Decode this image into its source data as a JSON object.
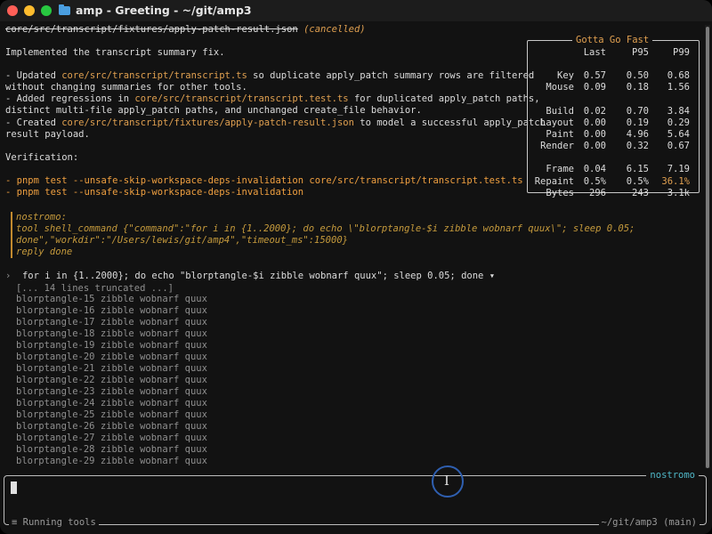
{
  "window": {
    "title": "amp - Greeting - ~/git/amp3"
  },
  "header": {
    "file": "core/src/transcript/fixtures/apply-patch-result.json",
    "status": "(cancelled)"
  },
  "summary": {
    "intro": "Implemented the transcript summary fix.",
    "b1_prefix": "- Updated ",
    "b1_path": "core/src/transcript/transcript.ts",
    "b1_rest": " so duplicate apply_patch summary rows are filtered",
    "b1_line2": "without changing summaries for other tools.",
    "b2_prefix": "- Added regressions in ",
    "b2_path": "core/src/transcript/transcript.test.ts",
    "b2_rest": " for duplicated apply_patch paths,",
    "b2_line2": "distinct multi-file apply_patch paths, and unchanged create_file behavior.",
    "b3_prefix": "- Created ",
    "b3_path": "core/src/transcript/fixtures/apply-patch-result.json",
    "b3_rest": " to model a successful apply_patch",
    "b3_line2": "result payload.",
    "verification": "Verification:",
    "v1_dash": "- ",
    "v1_cmd": "pnpm test --unsafe-skip-workspace-deps-invalidation core/src/transcript/transcript.test.ts",
    "v2_dash": "- ",
    "v2_cmd": "pnpm test --unsafe-skip-workspace-deps-invalidation"
  },
  "nostromo": {
    "header": "nostromo:",
    "line1": "tool shell_command {\"command\":\"for i in {1..2000}; do echo \\\"blorptangle-$i zibble wobnarf quux\\\"; sleep 0.05;",
    "line2": "done\",\"workdir\":\"/Users/lewis/git/amp4\",\"timeout_ms\":15000}",
    "line3": "reply done"
  },
  "shell": {
    "prompt": "›",
    "command": "for i in {1..2000}; do echo \"blorptangle-$i zibble wobnarf quux\"; sleep 0.05; done",
    "toggle": "▾",
    "truncated": "[... 14 lines truncated ...]",
    "output": [
      "blorptangle-15 zibble wobnarf quux",
      "blorptangle-16 zibble wobnarf quux",
      "blorptangle-17 zibble wobnarf quux",
      "blorptangle-18 zibble wobnarf quux",
      "blorptangle-19 zibble wobnarf quux",
      "blorptangle-20 zibble wobnarf quux",
      "blorptangle-21 zibble wobnarf quux",
      "blorptangle-22 zibble wobnarf quux",
      "blorptangle-23 zibble wobnarf quux",
      "blorptangle-24 zibble wobnarf quux",
      "blorptangle-25 zibble wobnarf quux",
      "blorptangle-26 zibble wobnarf quux",
      "blorptangle-27 zibble wobnarf quux",
      "blorptangle-28 zibble wobnarf quux",
      "blorptangle-29 zibble wobnarf quux"
    ]
  },
  "perf": {
    "title": "Gotta Go Fast",
    "headers": [
      "Last",
      "P95",
      "P99"
    ],
    "rows": [
      {
        "label": "Key",
        "last": "0.57",
        "p95": "0.50",
        "p99": "0.68"
      },
      {
        "label": "Mouse",
        "last": "0.09",
        "p95": "0.18",
        "p99": "1.56"
      },
      {
        "label": "Build",
        "last": "0.02",
        "p95": "0.70",
        "p99": "3.84"
      },
      {
        "label": "Layout",
        "last": "0.00",
        "p95": "0.19",
        "p99": "0.29"
      },
      {
        "label": "Paint",
        "last": "0.00",
        "p95": "4.96",
        "p99": "5.64"
      },
      {
        "label": "Render",
        "last": "0.00",
        "p95": "0.32",
        "p99": "0.67"
      },
      {
        "label": "Frame",
        "last": "0.04",
        "p95": "6.15",
        "p99": "7.19"
      },
      {
        "label": "Repaint",
        "last": "0.5%",
        "p95": "0.5%",
        "p99": "36.1%"
      },
      {
        "label": "Bytes",
        "last": "296",
        "p95": "243",
        "p99": "3.1k"
      }
    ]
  },
  "input": {
    "agent_label": "nostromo",
    "value": ""
  },
  "status": {
    "left": "≡ Running tools",
    "right": "~/git/amp3 (main)"
  },
  "colors": {
    "accent": "#e0a050",
    "agent": "#4fb7c7",
    "nostromo": "#c59a3c"
  }
}
